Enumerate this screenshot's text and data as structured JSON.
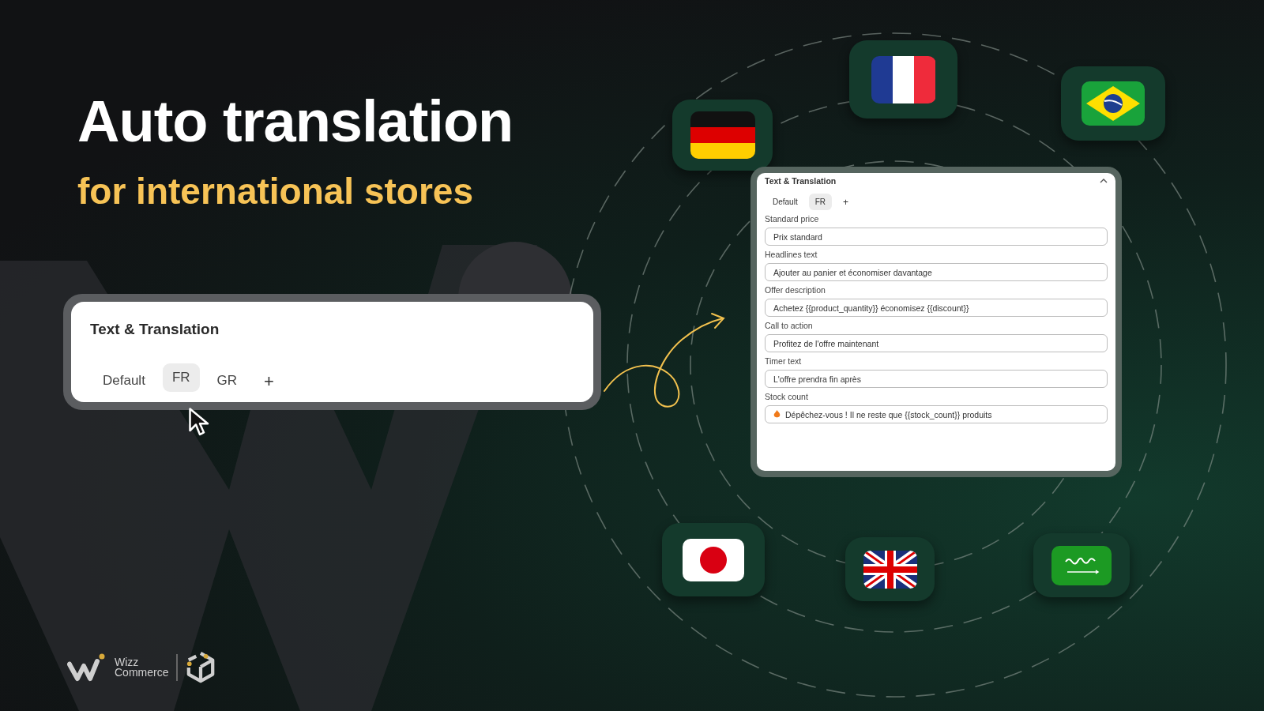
{
  "headline": "Auto translation",
  "subheadline": "for international stores",
  "card": {
    "title": "Text & Translation",
    "tabs": [
      {
        "label": "Default",
        "selected": false
      },
      {
        "label": "FR",
        "selected": true
      },
      {
        "label": "GR",
        "selected": false
      }
    ],
    "add": "+"
  },
  "panel": {
    "title": "Text & Translation",
    "tabs": [
      {
        "label": "Default",
        "selected": false
      },
      {
        "label": "FR",
        "selected": true
      }
    ],
    "add": "+",
    "fields": [
      {
        "label": "Standard price",
        "value": "Prix standard",
        "kind": "plain"
      },
      {
        "label": "Headlines text",
        "value": "Ajouter au panier et économiser davantage",
        "kind": "plain"
      },
      {
        "label": "Offer description",
        "value": "Achetez {{product_quantity}} économisez {{discount}}",
        "kind": "plain"
      },
      {
        "label": "Call to action",
        "value": "Profitez de l'offre maintenant",
        "kind": "plain"
      },
      {
        "label": "Timer text",
        "value": "L'offre prendra fin après",
        "kind": "plain"
      },
      {
        "label": "Stock count",
        "value": "Dépêchez-vous ! Il ne reste que {{stock_count}} produits",
        "kind": "flame"
      }
    ]
  },
  "brand": {
    "lines": [
      "Wizz",
      "Commerce"
    ]
  }
}
